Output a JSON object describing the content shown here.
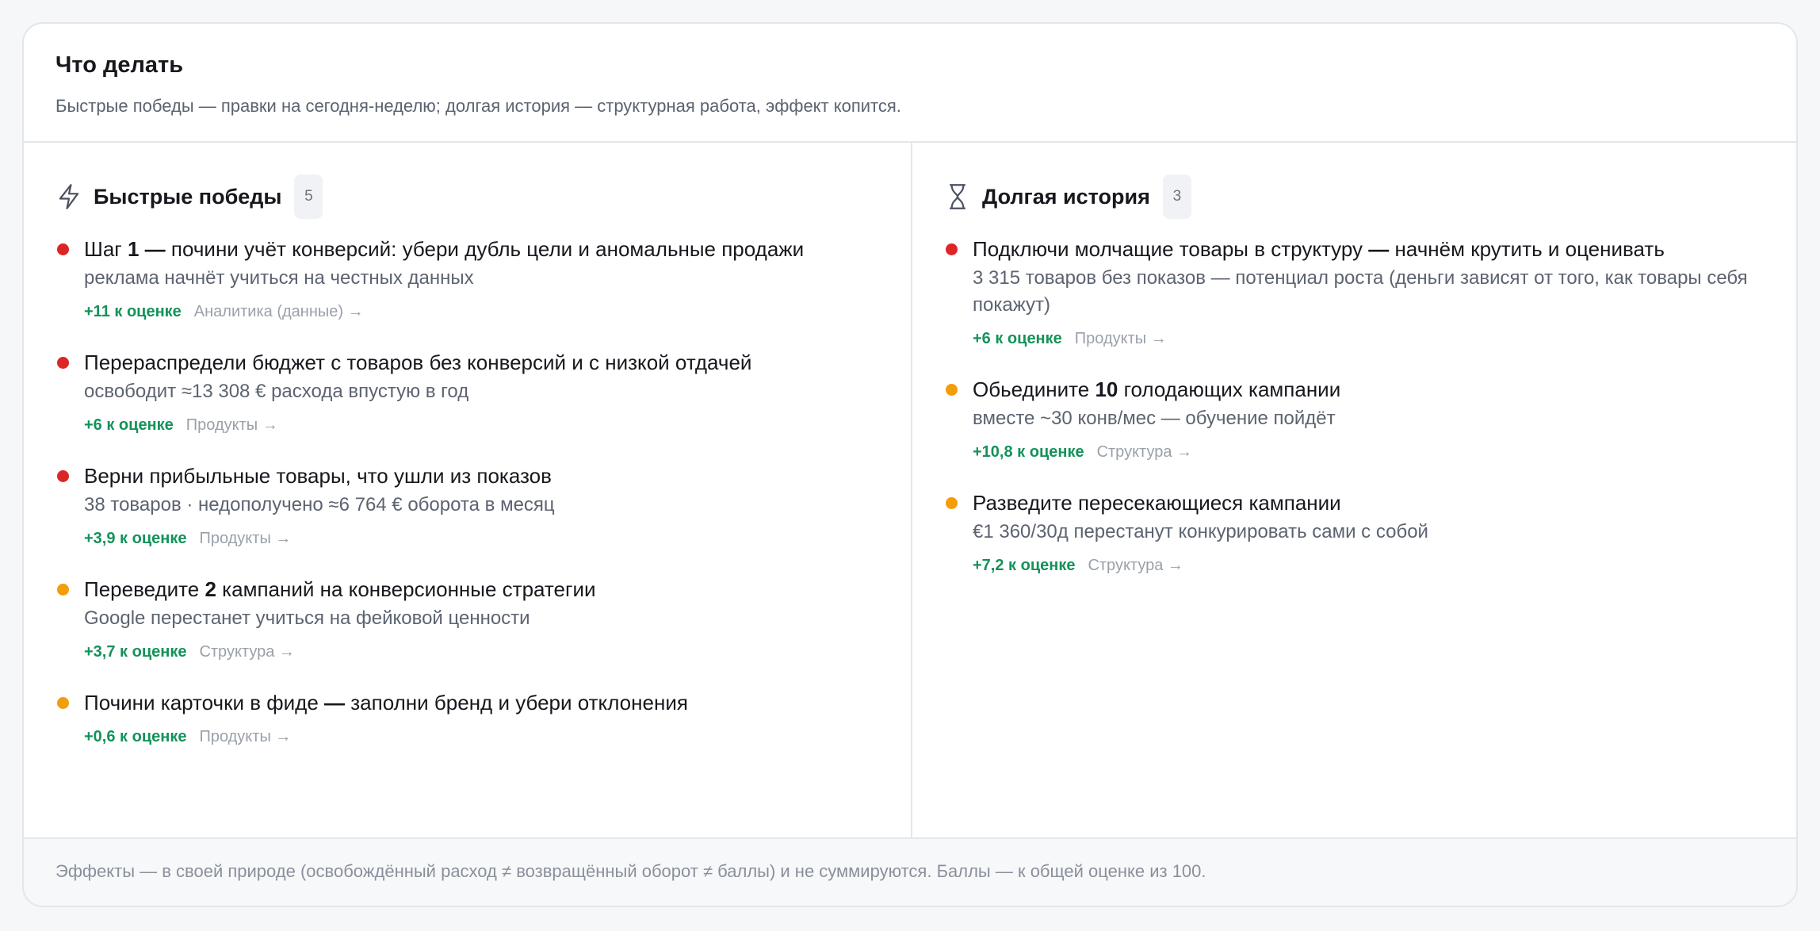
{
  "header": {
    "title": "Что делать",
    "subtitle": "Быстрые победы — правки на сегодня-неделю; долгая история — структурная работа, эффект копится."
  },
  "colors": {
    "red": "#dc2626",
    "amber": "#f29d0b",
    "green": "#14925a"
  },
  "quick": {
    "icon": "lightning-icon",
    "title": "Быстрые победы",
    "count": "5",
    "items": [
      {
        "severity": "red",
        "title_pre": "Шаг ",
        "title_bold": "1 —",
        "title_post": " почини учёт конверсий: убери дубль цели и аномальные продажи",
        "desc": "реклама начнёт учиться на честных данных",
        "gain": "+11 к оценке",
        "link": "Аналитика (данные) →"
      },
      {
        "severity": "red",
        "title_pre": "Перераспредели бюджет с товаров без конверсий и с низкой отдачей",
        "title_bold": "",
        "title_post": "",
        "desc": "освободит ≈13 308 € расхода впустую в год",
        "gain": "+6 к оценке",
        "link": "Продукты →"
      },
      {
        "severity": "red",
        "title_pre": "Верни прибыльные товары, что ушли из показов",
        "title_bold": "",
        "title_post": "",
        "desc": "38 товаров · недополучено ≈6 764 € оборота в месяц",
        "gain": "+3,9 к оценке",
        "link": "Продукты →"
      },
      {
        "severity": "amber",
        "title_pre": "Переведите ",
        "title_bold": "2",
        "title_post": " кампаний на конверсионные стратегии",
        "desc": "Google перестанет учиться на фейковой ценности",
        "gain": "+3,7 к оценке",
        "link": "Структура →"
      },
      {
        "severity": "amber",
        "title_pre": "Почини карточки в фиде ",
        "title_bold": "—",
        "title_post": " заполни бренд и убери отклонения",
        "desc": "",
        "gain": "+0,6 к оценке",
        "link": "Продукты →"
      }
    ]
  },
  "long": {
    "icon": "hourglass-icon",
    "title": "Долгая история",
    "count": "3",
    "items": [
      {
        "severity": "red",
        "title_pre": "Подключи молчащие товары в структуру ",
        "title_bold": "—",
        "title_post": " начнём крутить и оценивать",
        "desc": "3 315 товаров без показов — потенциал роста (деньги зависят от того, как товары себя покажут)",
        "gain": "+6 к оценке",
        "link": "Продукты →"
      },
      {
        "severity": "amber",
        "title_pre": "Обьедините ",
        "title_bold": "10",
        "title_post": " голодающих кампании",
        "desc": "вместе ~30 конв/мес — обучение пойдёт",
        "gain": "+10,8 к оценке",
        "link": "Структура →"
      },
      {
        "severity": "amber",
        "title_pre": "Разведите пересекающиеся кампании",
        "title_bold": "",
        "title_post": "",
        "desc": "€1 360/30д перестанут конкурировать сами с собой",
        "gain": "+7,2 к оценке",
        "link": "Структура →"
      }
    ]
  },
  "footer": {
    "text": "Эффекты — в своей природе (освобождённый расход ≠ возвращённый оборот ≠ баллы) и не суммируются. Баллы — к общей оценке из 100."
  }
}
